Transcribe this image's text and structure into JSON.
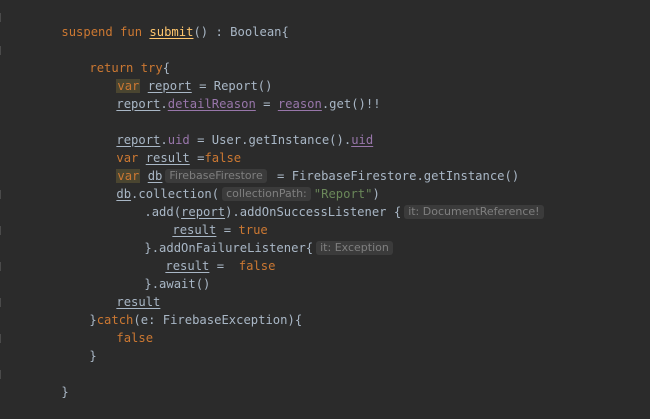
{
  "code": {
    "l1": {
      "kw1": "suspend fun ",
      "fn": "submit",
      "rest": "() : Boolean{"
    },
    "l2": {
      "kw": "return try",
      "rest": "{"
    },
    "l3": {
      "kw": "var",
      "v": "report",
      "rest": " = Report()"
    },
    "l4": {
      "a": "report",
      "dot": ".",
      "b": "detailReason",
      "eq": " = ",
      "c": "reason",
      "rest": ".get()!!"
    },
    "l5": {
      "a": "report",
      "dot": ".",
      "b": "uid",
      "mid": " = User.getInstance().",
      "c": "uid"
    },
    "l6": {
      "kw": "var",
      "v": "result",
      "eq": " =",
      "val": "false"
    },
    "l7": {
      "kw": "var",
      "v": "db",
      "hint": "FirebaseFirestore",
      "rest": " = FirebaseFirestore.getInstance()"
    },
    "l8": {
      "a": "db",
      "rest": ".collection(",
      "hint": "collectionPath:",
      "str": "\"Report\"",
      "close": ")"
    },
    "l9": {
      "pre": ".add(",
      "a": "report",
      "rest": ").addOnSuccessListener {",
      "hint": "it: DocumentReference!"
    },
    "l10": {
      "v": "result",
      "eq": " = ",
      "val": "true"
    },
    "l11": {
      "rest": "}.addOnFailureListener{",
      "hint": "it: Exception"
    },
    "l12": {
      "v": "result",
      "eq": " =  ",
      "val": "false"
    },
    "l13": {
      "rest": "}.await()"
    },
    "l14": {
      "v": "result"
    },
    "l15": {
      "pre": "}",
      "kw": "catch",
      "rest": "(e: FirebaseException){"
    },
    "l16": {
      "val": "false"
    },
    "l17": {
      "rest": "}"
    },
    "l18": {
      "rest": "}"
    }
  }
}
